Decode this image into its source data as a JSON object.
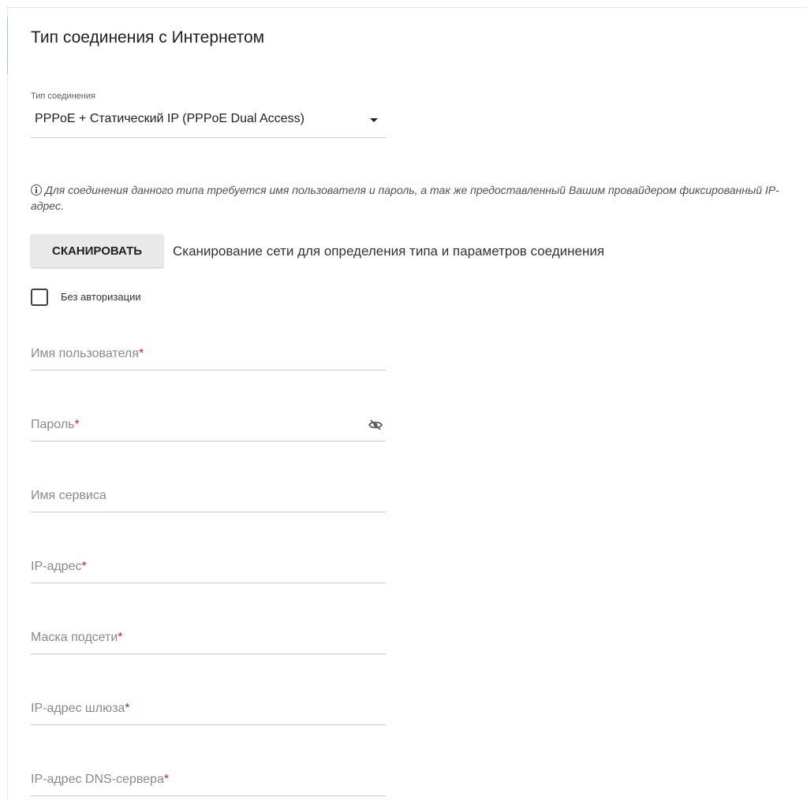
{
  "section": {
    "title": "Тип соединения с Интернетом"
  },
  "connection_type": {
    "label": "Тип соединения",
    "value": "PPPoE + Статический IP (PPPoE Dual Access)"
  },
  "info": {
    "text": "Для соединения данного типа требуется имя пользователя и пароль, а так же предоставленный Вашим провайдером фиксированный IP-адрес."
  },
  "scan": {
    "button_label": "СКАНИРОВАТЬ",
    "description": "Сканирование сети для определения типа и параметров соединения"
  },
  "no_auth": {
    "label": "Без авторизации",
    "checked": false
  },
  "fields": {
    "username": {
      "label": "Имя пользователя",
      "required_mark": "*"
    },
    "password": {
      "label": "Пароль",
      "required_mark": "*"
    },
    "service_name": {
      "label": "Имя сервиса"
    },
    "ip_address": {
      "label": "IP-адрес",
      "required_mark": "*"
    },
    "subnet_mask": {
      "label": "Маска подсети",
      "required_mark": "*"
    },
    "gateway": {
      "label": "IP-адрес шлюза",
      "required_mark": "*"
    },
    "dns": {
      "label": "IP-адрес DNS-сервера",
      "required_mark": "*"
    }
  },
  "colors": {
    "required": "#c62828",
    "frame_accent": "#9fc4d6",
    "button_bg": "#e9e9e9"
  },
  "icons": {
    "info": "info-circle-icon",
    "password_toggle": "eye-off-icon",
    "dropdown": "caret-down-icon"
  }
}
